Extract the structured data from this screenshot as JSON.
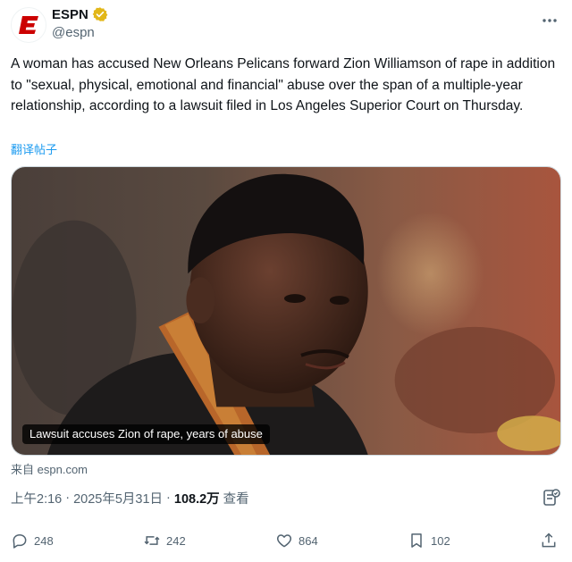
{
  "account": {
    "display_name": "ESPN",
    "handle": "@espn",
    "brand_color": "#cc0000",
    "verified_color": "#e2b719"
  },
  "icons": {
    "more": "ellipsis-icon",
    "verified": "verified-badge-icon",
    "reply": "comment-icon",
    "retweet": "retweet-icon",
    "like": "heart-icon",
    "bookmark": "bookmark-icon",
    "share": "share-icon",
    "grok": "grok-icon"
  },
  "tweet": {
    "text": "A woman has accused New Orleans Pelicans forward Zion Williamson of rape in addition to \"sexual, physical, emotional and financial\" abuse over the span of a multiple-year relationship, according to a lawsuit filed in Los Angeles Superior Court on Thursday.",
    "translate_label": "翻译帖子"
  },
  "card": {
    "caption": "Lawsuit accuses Zion of rape, years of abuse"
  },
  "source": {
    "prefix": "来自",
    "domain": "espn.com"
  },
  "meta": {
    "time": "上午2:16",
    "date": "2025年5月31日",
    "views_count": "108.2万",
    "views_label": "查看"
  },
  "stats": {
    "replies": "248",
    "retweets": "242",
    "likes": "864",
    "bookmarks": "102"
  },
  "colors": {
    "text_primary": "#0f1419",
    "text_secondary": "#536471",
    "link": "#1d9bf0"
  }
}
